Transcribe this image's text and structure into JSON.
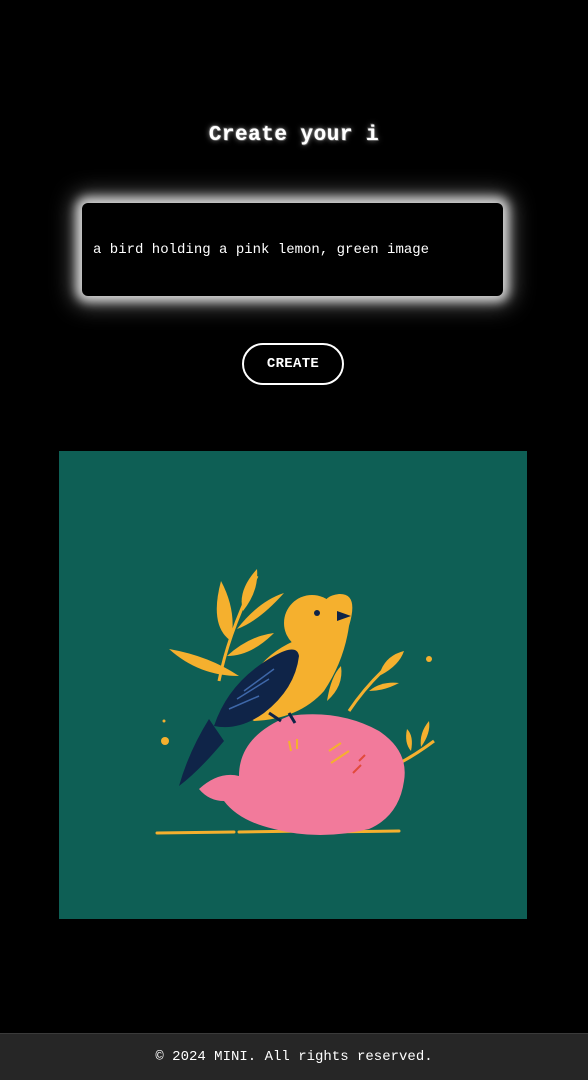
{
  "header": {
    "title": "Create your i"
  },
  "prompt": {
    "value": "a bird holding a pink lemon, green image",
    "placeholder": ""
  },
  "actions": {
    "create_label": "CREATE"
  },
  "result": {
    "image_icon": "bird-on-pink-lemon-illustration",
    "background_color": "#0e5f55",
    "bird_color": "#f5b02e",
    "wing_color": "#0f2448",
    "lemon_color": "#f27a9b"
  },
  "footer": {
    "copyright": "© 2024 MINI. All rights reserved."
  }
}
